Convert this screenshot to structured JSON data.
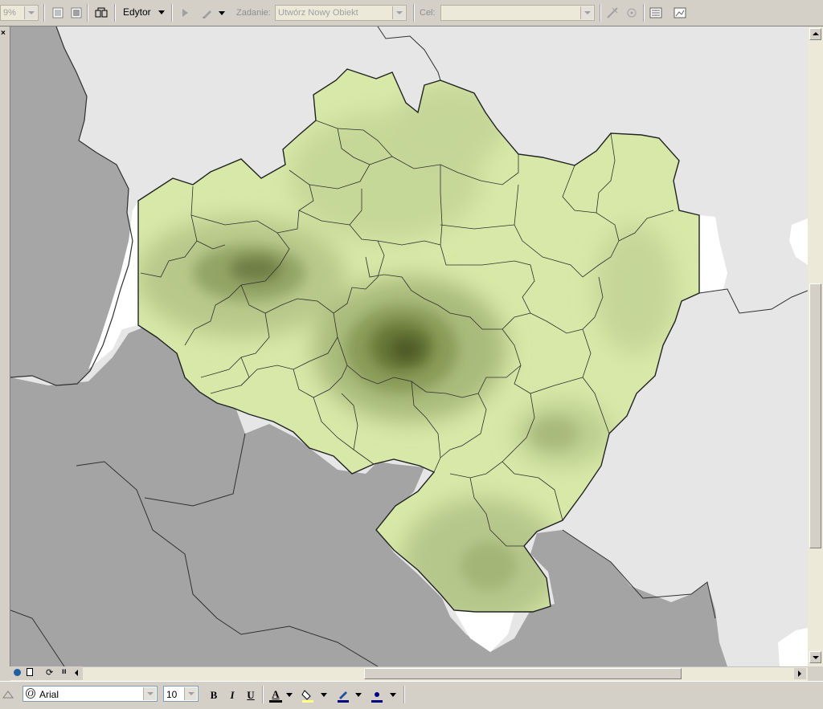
{
  "toolbar": {
    "zoom_value": "9%",
    "editor_menu": "Edytor",
    "task_label": "Zadanie:",
    "task_value": "Utwórz Nowy Obiekt",
    "target_label": "Cel:",
    "target_value": ""
  },
  "format_bar": {
    "font_name": "Arial",
    "font_size": "10",
    "bold": "B",
    "italic": "I",
    "underline": "U",
    "font_color_glyph": "A"
  },
  "colors": {
    "map_fill_light": "#d8e9a8",
    "map_fill_dark": "#4f5a25",
    "neighbor_gray": "#a4a4a4",
    "background": "#e6e6e6"
  }
}
